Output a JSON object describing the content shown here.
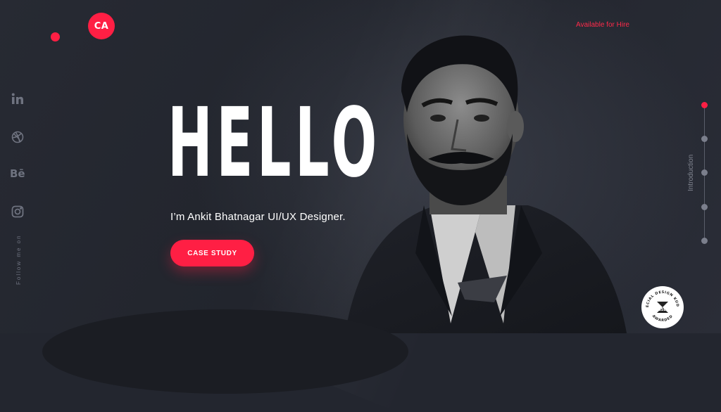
{
  "brand": {
    "logo_text": "CA"
  },
  "header": {
    "hire_label": "Available for Hire"
  },
  "social": {
    "icons": [
      "linkedin-icon",
      "dribbble-icon",
      "behance-icon",
      "instagram-icon"
    ],
    "behance_text": "Bē",
    "follow_label": "Follow me on"
  },
  "hero": {
    "heading": "HELLO",
    "subtitle": "I’m Ankit Bhatnagar UI/UX Designer.",
    "cta_label": "CASE STUDY"
  },
  "section_nav": {
    "active_label": "Introduction",
    "active_index": 0,
    "count": 5
  },
  "badge": {
    "top_text": "SPECIAL DESIGN KUDOS",
    "center_text": "CSSDA",
    "bottom_text": "AWARDED"
  },
  "colors": {
    "accent": "#ff1f44",
    "background": "#23262f",
    "muted": "#6f7380"
  }
}
